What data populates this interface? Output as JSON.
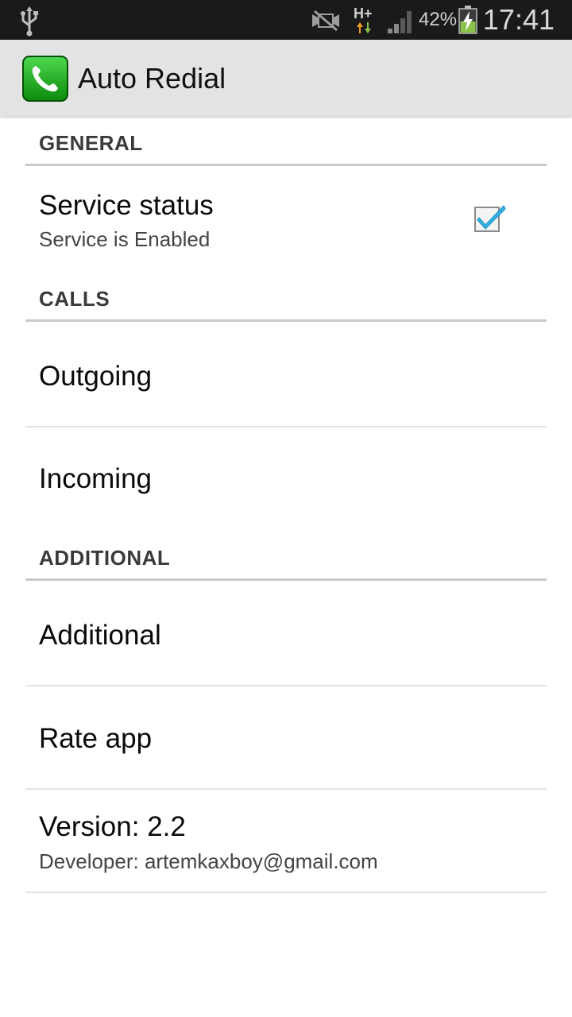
{
  "status_bar": {
    "network_label": "H+",
    "battery_percent": "42%",
    "time": "17:41",
    "icons": [
      "usb-icon",
      "no-sound-icon",
      "network-hplus-icon",
      "signal-icon",
      "battery-charging-icon"
    ]
  },
  "action_bar": {
    "title": "Auto Redial",
    "icon": "phone-app-icon",
    "icon_color": "#19a619"
  },
  "categories": {
    "general": "GENERAL",
    "calls": "CALLS",
    "additional": "ADDITIONAL"
  },
  "prefs": {
    "service_status": {
      "title": "Service status",
      "summary": "Service is Enabled",
      "checked": true
    },
    "outgoing": {
      "title": "Outgoing"
    },
    "incoming": {
      "title": "Incoming"
    },
    "additional": {
      "title": "Additional"
    },
    "rate_app": {
      "title": "Rate app"
    },
    "version": {
      "title": "Version: 2.2",
      "summary": "Developer: artemkaxboy@gmail.com"
    }
  },
  "colors": {
    "status_bar_bg": "#1a1a1a",
    "action_bar_bg": "#e3e3e3",
    "checkbox_check": "#33b5e5"
  }
}
